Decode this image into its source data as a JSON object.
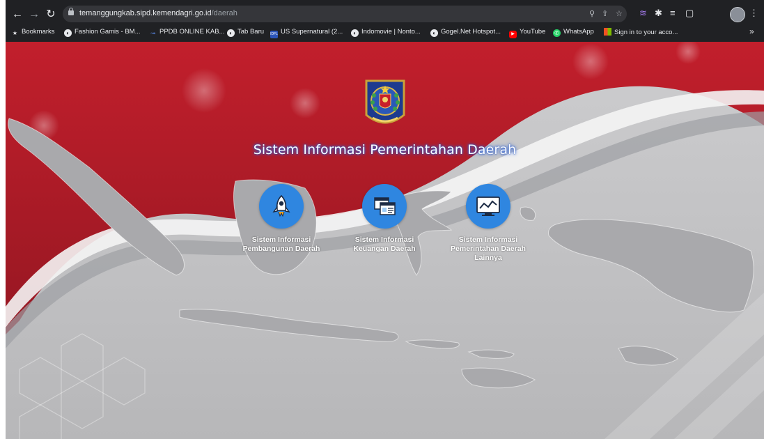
{
  "browser": {
    "url_host": "temanggungkab.sipd.kemendagri.go.id",
    "url_path": "/daerah",
    "nav_icons": [
      "back-arrow-icon",
      "forward-arrow-icon",
      "reload-icon"
    ],
    "bookmarks": [
      {
        "label": "Bookmarks",
        "icon": "star-icon"
      },
      {
        "label": "Fashion Gamis - BM...",
        "icon": "globe-icon"
      },
      {
        "label": "PPDB ONLINE KAB...",
        "icon": "ppdb-icon"
      },
      {
        "label": "Tab Baru",
        "icon": "globe-icon"
      },
      {
        "label": "US Supernatural (2...",
        "icon": "idfl-icon"
      },
      {
        "label": "Indomovie | Nonto...",
        "icon": "globe-icon"
      },
      {
        "label": "Gogel.Net Hotspot...",
        "icon": "globe-icon"
      },
      {
        "label": "YouTube",
        "icon": "youtube-icon"
      },
      {
        "label": "WhatsApp",
        "icon": "whatsapp-icon"
      },
      {
        "label": "Sign in to your acco...",
        "icon": "microsoft-icon"
      }
    ],
    "more_bookmarks": "»"
  },
  "page": {
    "title": "Sistem Informasi Pemerintahan Daerah",
    "menu": [
      {
        "line1": "Sistem Informasi",
        "line2": "Pembangunan Daerah",
        "line3": "",
        "icon": "rocket-icon"
      },
      {
        "line1": "Sistem Informasi",
        "line2": "Keuangan Daerah",
        "line3": "",
        "icon": "browser-windows-icon"
      },
      {
        "line1": "Sistem Informasi",
        "line2": "Pemerintahan Daerah",
        "line3": "Lainnya",
        "icon": "monitor-chart-icon"
      }
    ]
  },
  "colors": {
    "chrome": "#202124",
    "accent_red": "#b21f2a",
    "icon_blue": "#2f86e0",
    "title_glow": "#2f63d6"
  }
}
